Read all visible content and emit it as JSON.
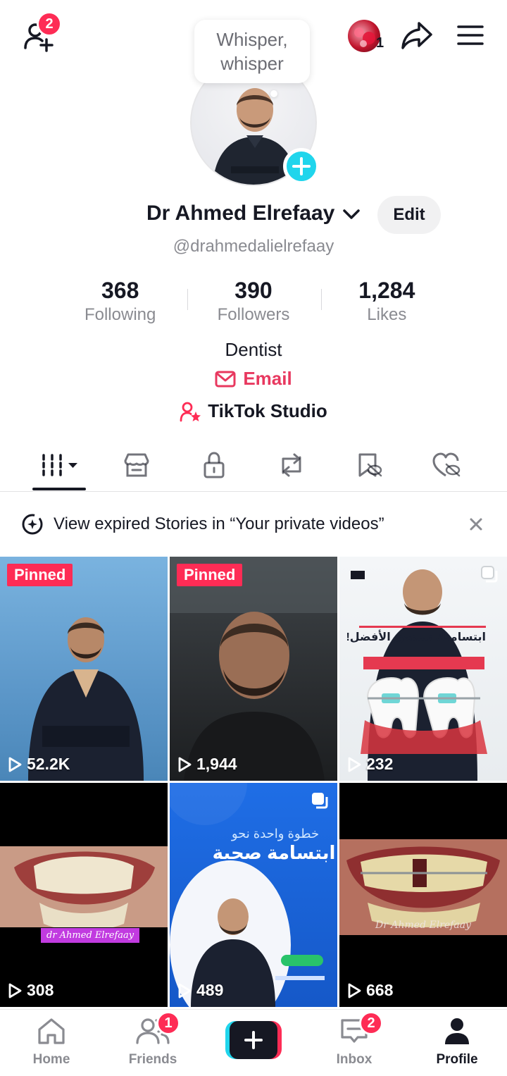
{
  "header": {
    "add_friends_badge": "2",
    "story_count": "1"
  },
  "profile": {
    "note": "Whisper, whisper",
    "name": "Dr Ahmed Elrefaay",
    "edit_label": "Edit",
    "handle": "@drahmedalielrefaay",
    "stats": [
      {
        "value": "368",
        "label": "Following"
      },
      {
        "value": "390",
        "label": "Followers"
      },
      {
        "value": "1,284",
        "label": "Likes"
      }
    ],
    "bio": "Dentist",
    "email_label": "Email",
    "studio_label": "TikTok Studio"
  },
  "tabs": [
    "videos-icon",
    "shop-icon",
    "lock-icon",
    "repost-icon",
    "favorites-icon",
    "liked-icon"
  ],
  "story_banner": {
    "text": "View expired Stories in “Your private videos”"
  },
  "videos": [
    {
      "views": "52.2K",
      "pinned": "Pinned"
    },
    {
      "views": "1,944",
      "pinned": "Pinned"
    },
    {
      "views": "232",
      "overlay_title": "ابتسامتك تستحق الأفضل!"
    },
    {
      "views": "308",
      "caption": "dr Ahmed Elrefaay"
    },
    {
      "views": "489",
      "overlay_sub": "خطوة واحدة نحو",
      "overlay_title": "ابتسامة صحية"
    },
    {
      "views": "668",
      "caption": "Dr Ahmed Elrefaay"
    }
  ],
  "nav": {
    "home": "Home",
    "friends": "Friends",
    "friends_badge": "1",
    "inbox": "Inbox",
    "inbox_badge": "2",
    "profile": "Profile"
  },
  "colors": {
    "accent": "#fe2c55",
    "link": "#e8385f",
    "plus": "#20d5ec"
  }
}
